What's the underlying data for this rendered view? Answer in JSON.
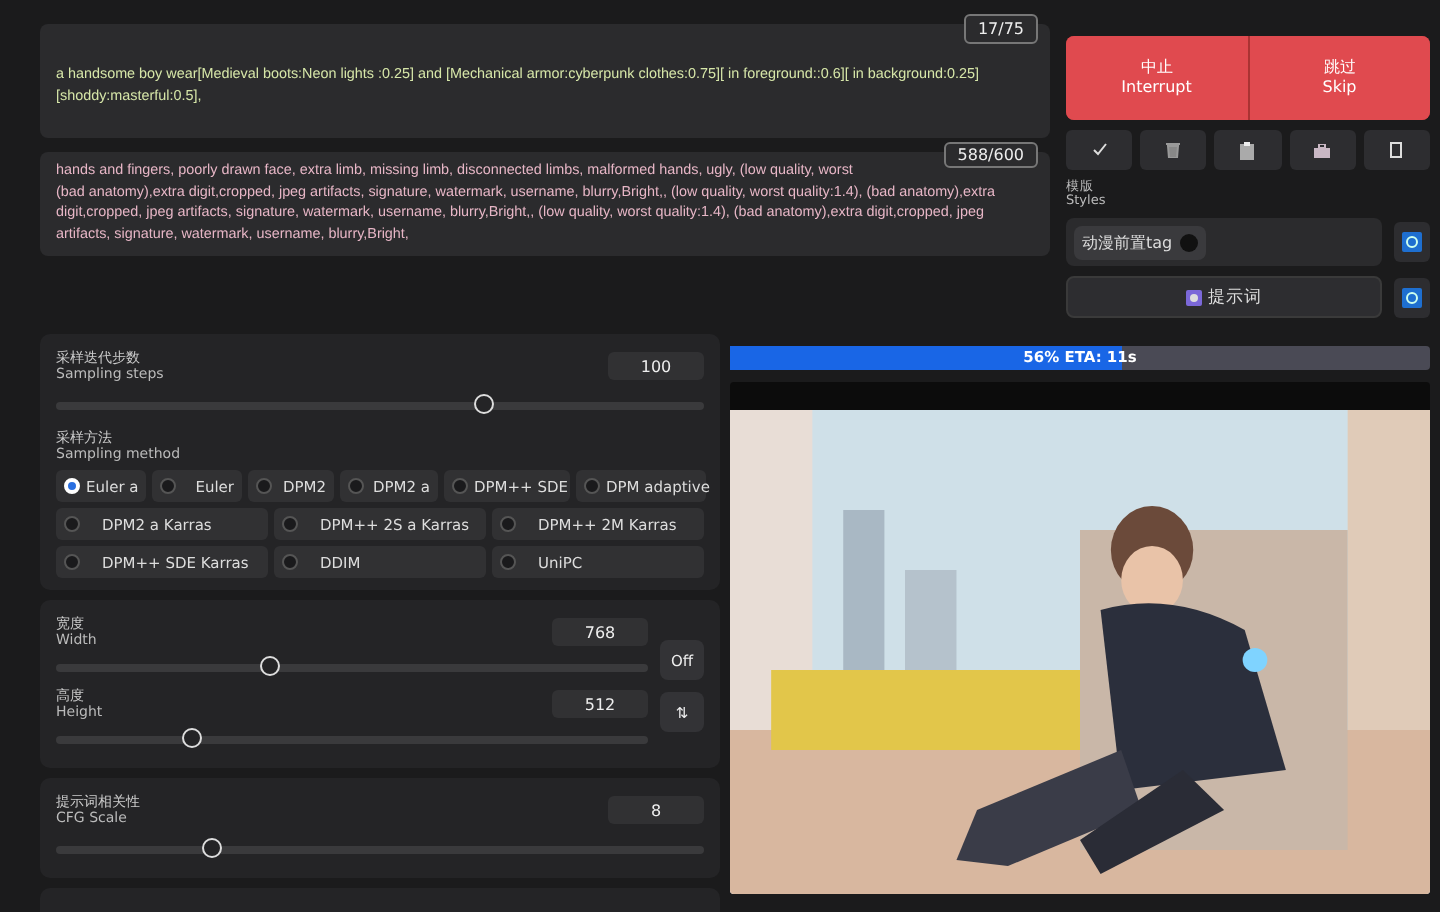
{
  "prompt": {
    "text": "a handsome boy wear[Medieval boots:Neon lights :0.25] and [Mechanical armor:cyberpunk clothes:0.75][ in foreground::0.6][ in background:0.25][shoddy:masterful:0.5],",
    "counter": "17/75"
  },
  "negative_prompt": {
    "first_line": "hands and fingers, poorly drawn face, extra limb, missing limb, disconnected limbs, malformed hands, ugly, (low quality, worst",
    "text": "(bad anatomy),extra digit,cropped, jpeg artifacts, signature, watermark, username, blurry,Bright,, (low quality, worst quality:1.4), (bad anatomy),extra digit,cropped, jpeg artifacts, signature, watermark, username, blurry,Bright,, (low quality, worst quality:1.4), (bad anatomy),extra digit,cropped, jpeg artifacts, signature, watermark, username, blurry,Bright,",
    "counter": "588/600"
  },
  "actions": [
    {
      "zh": "中止",
      "en": "Interrupt"
    },
    {
      "zh": "跳过",
      "en": "Skip"
    }
  ],
  "tool_buttons": [
    {
      "kind": "check"
    },
    {
      "kind": "trash"
    },
    {
      "kind": "clipboard"
    },
    {
      "kind": "briefcase"
    },
    {
      "kind": "square"
    }
  ],
  "styles": {
    "label_zh": "模版",
    "label_en": "Styles",
    "chips": [
      "动漫前置tag"
    ]
  },
  "prompt_button": "提示词",
  "sampling_steps": {
    "label_zh": "采样迭代步数",
    "label_en": "Sampling steps",
    "value": "100",
    "level": 0.66
  },
  "sampling_method": {
    "label_zh": "采样方法",
    "label_en": "Sampling method",
    "options": [
      {
        "label": "Euler a",
        "selected": true
      },
      {
        "label": "Euler",
        "selected": false
      },
      {
        "label": "DPM2",
        "selected": false
      },
      {
        "label": "DPM2 a",
        "selected": false
      },
      {
        "label": "DPM++ SDE",
        "selected": false
      },
      {
        "label": "DPM adaptive",
        "selected": false
      },
      {
        "label": "DPM2 a Karras",
        "selected": false
      },
      {
        "label": "DPM++ 2S a Karras",
        "selected": false
      },
      {
        "label": "DPM++ 2M Karras",
        "selected": false
      },
      {
        "label": "DPM++ SDE Karras",
        "selected": false
      },
      {
        "label": "DDIM",
        "selected": false
      },
      {
        "label": "UniPC",
        "selected": false
      }
    ]
  },
  "width": {
    "label_zh": "宽度",
    "label_en": "Width",
    "value": "768",
    "level": 0.36
  },
  "height": {
    "label_zh": "高度",
    "label_en": "Height",
    "value": "512",
    "level": 0.23
  },
  "size_buttons": {
    "off": "Off",
    "swap": "⇅"
  },
  "cfg_scale": {
    "label_zh": "提示词相关性",
    "label_en": "CFG Scale",
    "value": "8",
    "level": 0.24
  },
  "progress": {
    "text": "56% ETA: 11s",
    "level": 0.56
  }
}
